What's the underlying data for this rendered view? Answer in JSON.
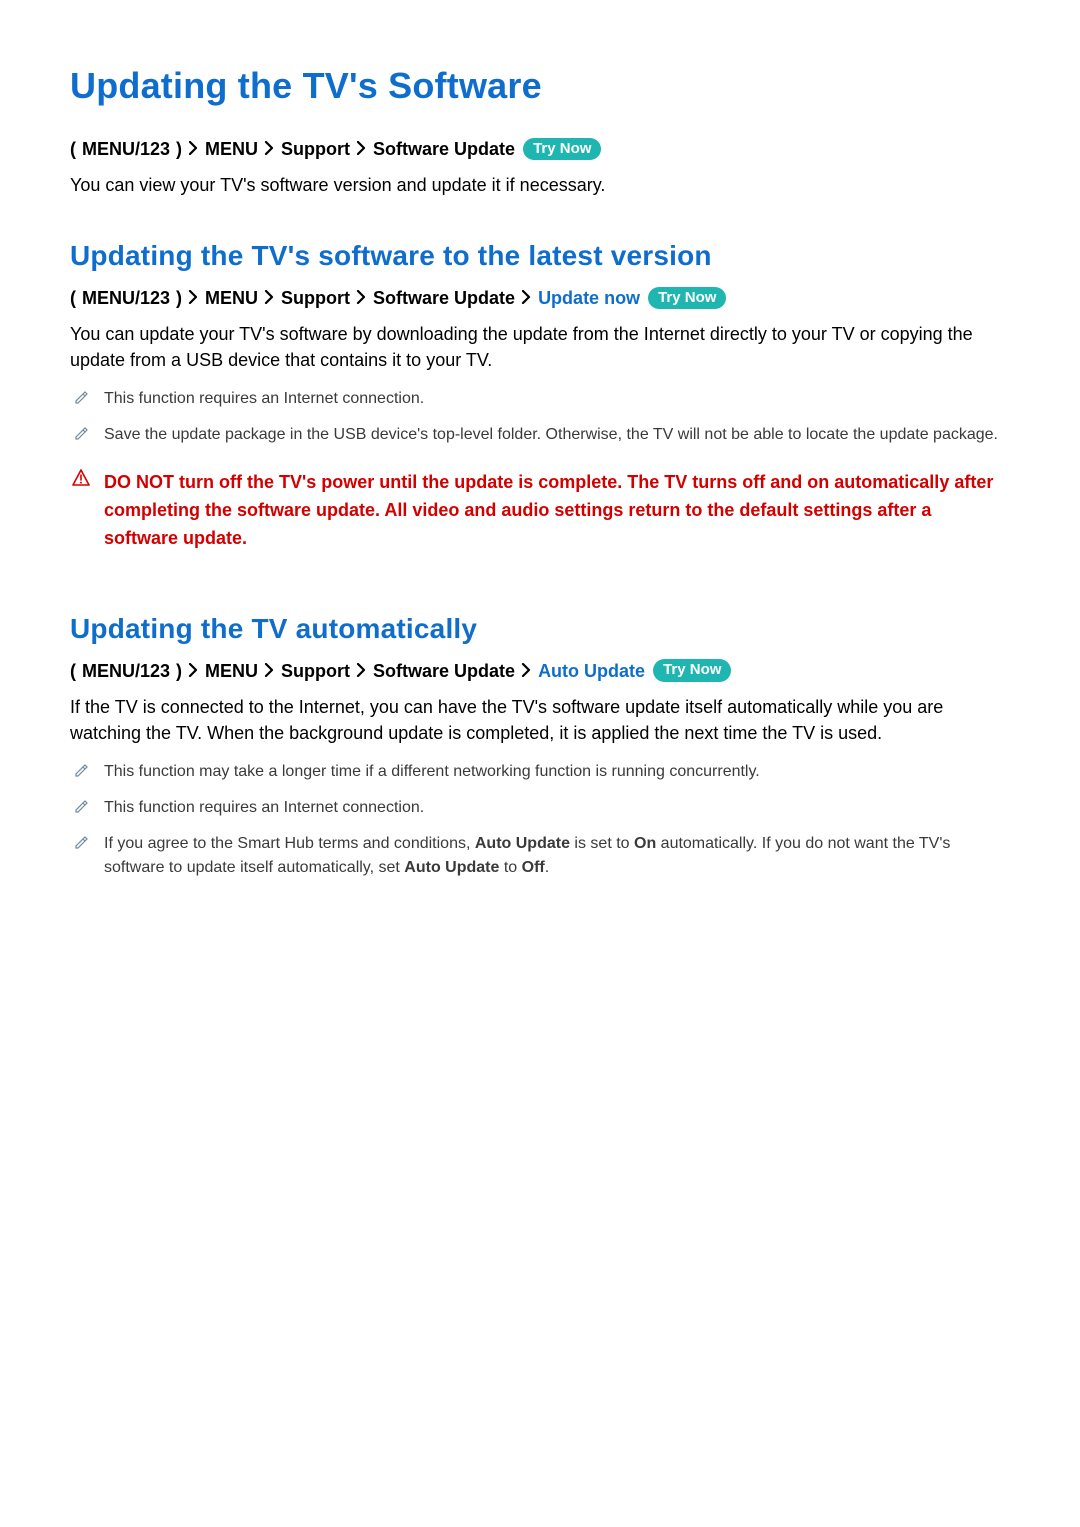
{
  "tryNowLabel": "Try Now",
  "header": {
    "title": "Updating the TV's Software",
    "breadcrumb": {
      "paren_open": "(",
      "btn": "MENU/123",
      "paren_close": ")",
      "menu": "MENU",
      "support": "Support",
      "softwareUpdate": "Software Update"
    },
    "intro": "You can view your TV's software version and update it if necessary."
  },
  "section1": {
    "title": "Updating the TV's software to the latest version",
    "breadcrumb": {
      "paren_open": "(",
      "btn": "MENU/123",
      "paren_close": ")",
      "menu": "MENU",
      "support": "Support",
      "softwareUpdate": "Software Update",
      "updateNow": "Update now"
    },
    "body": "You can update your TV's software by downloading the update from the Internet directly to your TV or copying the update from a USB device that contains it to your TV.",
    "notes": [
      "This function requires an Internet connection.",
      "Save the update package in the USB device's top-level folder. Otherwise, the TV will not be able to locate the update package."
    ],
    "warning": "DO NOT turn off the TV's power until the update is complete. The TV turns off and on automatically after completing the software update. All video and audio settings return to the default settings after a software update."
  },
  "section2": {
    "title": "Updating the TV automatically",
    "breadcrumb": {
      "paren_open": "(",
      "btn": "MENU/123",
      "paren_close": ")",
      "menu": "MENU",
      "support": "Support",
      "softwareUpdate": "Software Update",
      "autoUpdate": "Auto Update"
    },
    "body": "If the TV is connected to the Internet, you can have the TV's software update itself automatically while you are watching the TV. When the background update is completed, it is applied the next time the TV is used.",
    "notes": [
      "This function may take a longer time if a different networking function is running concurrently.",
      "This function requires an Internet connection."
    ],
    "note3": {
      "pre": "If you agree to the Smart Hub terms and conditions, ",
      "b1": "Auto Update",
      "mid1": " is set to ",
      "b2": "On",
      "mid2": " automatically. If you do not want the TV's software to update itself automatically, set ",
      "b3": "Auto Update",
      "mid3": " to ",
      "b4": "Off",
      "end": "."
    }
  }
}
